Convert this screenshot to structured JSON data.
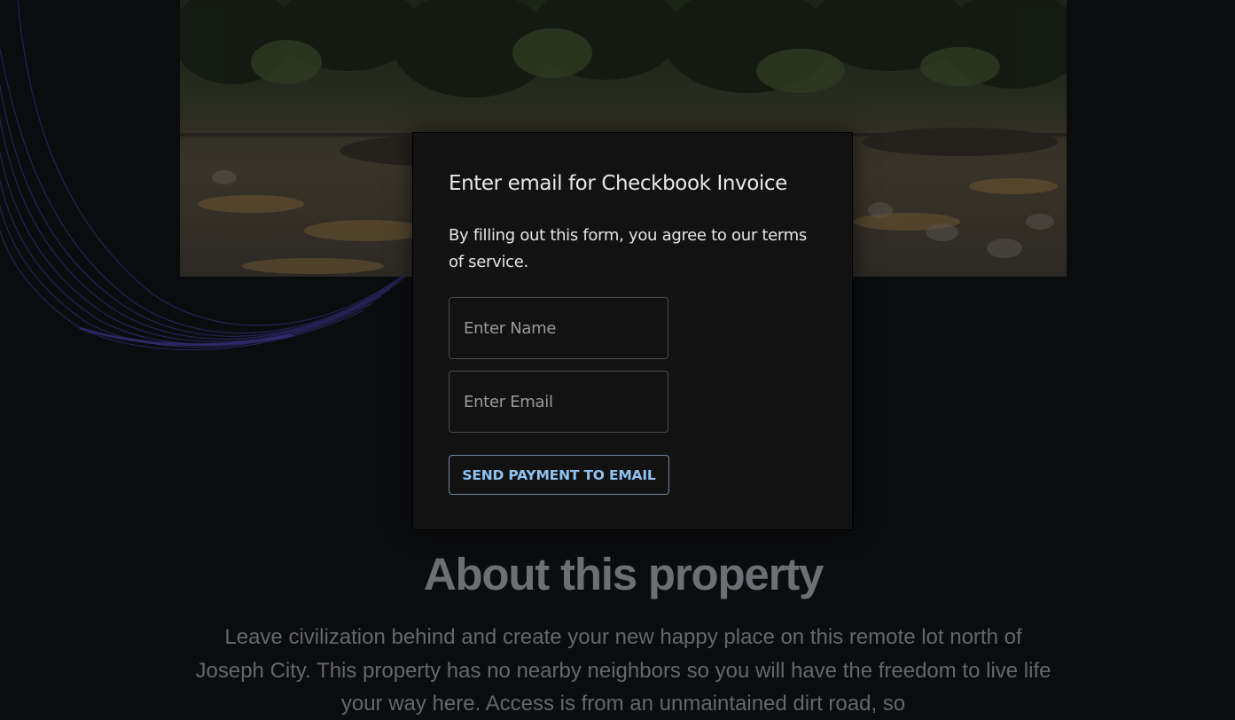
{
  "modal": {
    "title": "Enter email for Checkbook Invoice",
    "description": "By filling out this form, you agree to our terms of service.",
    "name_placeholder": "Enter Name",
    "email_placeholder": "Enter Email",
    "submit_label": "SEND PAYMENT TO EMAIL"
  },
  "about": {
    "title": "About this property",
    "text": "Leave civilization behind and create your new happy place on this remote lot north of Joseph City. This property has no nearby neighbors so you will have the freedom to live life your way here. Access is from an unmaintained dirt road, so"
  },
  "colors": {
    "background": "#0b0c0e",
    "modal_background": "#121212",
    "button_accent": "#8fc3f2",
    "wave_lines": "#2a2560"
  }
}
